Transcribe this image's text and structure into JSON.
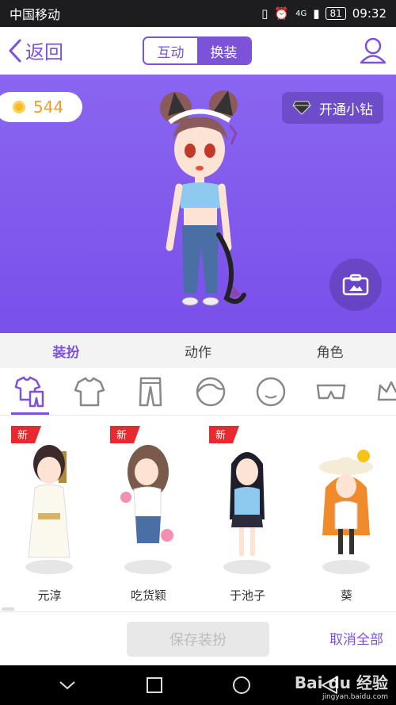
{
  "status_bar": {
    "carrier": "中国移动",
    "network": "4G",
    "battery": "81",
    "time": "09:32"
  },
  "nav": {
    "back_label": "返回",
    "segments": [
      "互动",
      "换装"
    ],
    "active_segment": 1
  },
  "stage": {
    "coins": "544",
    "vip_label": "开通小钻"
  },
  "tabs": {
    "items": [
      "装扮",
      "动作",
      "角色"
    ],
    "active": 0
  },
  "categories": [
    "outfit-set-icon",
    "top-icon",
    "pants-icon",
    "hair-icon",
    "face-icon",
    "glasses-icon",
    "crown-icon"
  ],
  "items": [
    {
      "name": "元淳",
      "badge": "新"
    },
    {
      "name": "吃货颖",
      "badge": "新"
    },
    {
      "name": "于池子",
      "badge": "新"
    },
    {
      "name": "葵",
      "badge": ""
    }
  ],
  "bottom": {
    "save_label": "保存装扮",
    "cancel_label": "取消全部"
  },
  "watermark": {
    "text": "Bai du 经验",
    "sub": "jingyan.baidu.com"
  },
  "colors": {
    "accent": "#7b52d8",
    "stage_bg": "#8a65f0",
    "coin": "#f39c27"
  }
}
